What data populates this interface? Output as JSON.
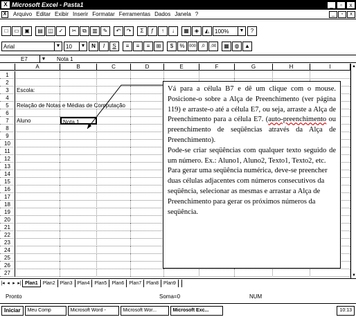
{
  "window": {
    "app_icon": "X",
    "title": "Microsoft Excel - Pasta1",
    "buttons": [
      "_",
      "▫",
      "x"
    ]
  },
  "menubar": {
    "items": [
      "Arquivo",
      "Editar",
      "Exibir",
      "Inserir",
      "Formatar",
      "Ferramentas",
      "Dados",
      "Janela",
      "?"
    ],
    "doc_buttons": [
      "_",
      "▫",
      "x"
    ]
  },
  "toolbar_standard": {
    "zoom": "100%",
    "icons": [
      "new-icon",
      "open-icon",
      "save-icon",
      "print-icon",
      "preview-icon",
      "spelling-icon",
      "cut-icon",
      "copy-icon",
      "paste-icon",
      "format-painter-icon",
      "undo-icon",
      "redo-icon",
      "autosum-icon",
      "function-icon",
      "sort-asc-icon",
      "sort-desc-icon",
      "chart-wizard-icon",
      "map-icon",
      "drawing-icon",
      "help-icon"
    ]
  },
  "toolbar_format": {
    "font": "Arial",
    "size": "10",
    "bold": "N",
    "italic": "I",
    "underline": "S",
    "currency": "$",
    "percent": "%",
    "thousands": "000",
    "dec_inc": ",0",
    "dec_dec": ",00"
  },
  "formula_bar": {
    "name_box": "E7",
    "content": "Nota 1"
  },
  "columns": [
    "A",
    "B",
    "C",
    "D",
    "E",
    "F",
    "G",
    "H",
    "I"
  ],
  "rows": [
    {
      "n": "1",
      "a": "",
      "b": ""
    },
    {
      "n": "2",
      "a": "",
      "b": ""
    },
    {
      "n": "3",
      "a": "Escola:",
      "b": ""
    },
    {
      "n": "4",
      "a": "",
      "b": ""
    },
    {
      "n": "5",
      "a": "Relação de Notas e Médias de Computação",
      "b": ""
    },
    {
      "n": "6",
      "a": "",
      "b": ""
    },
    {
      "n": "7",
      "a": "Aluno",
      "b": "Nota 1"
    },
    {
      "n": "8",
      "a": "",
      "b": ""
    },
    {
      "n": "9",
      "a": "",
      "b": ""
    },
    {
      "n": "10",
      "a": "",
      "b": ""
    },
    {
      "n": "11",
      "a": "",
      "b": ""
    },
    {
      "n": "12",
      "a": "",
      "b": ""
    },
    {
      "n": "13",
      "a": "",
      "b": ""
    },
    {
      "n": "14",
      "a": "",
      "b": ""
    },
    {
      "n": "15",
      "a": "",
      "b": ""
    },
    {
      "n": "16",
      "a": "",
      "b": ""
    },
    {
      "n": "17",
      "a": "",
      "b": ""
    },
    {
      "n": "18",
      "a": "",
      "b": ""
    },
    {
      "n": "19",
      "a": "",
      "b": ""
    },
    {
      "n": "20",
      "a": "",
      "b": ""
    },
    {
      "n": "21",
      "a": "",
      "b": ""
    },
    {
      "n": "22",
      "a": "",
      "b": ""
    },
    {
      "n": "23",
      "a": "",
      "b": ""
    },
    {
      "n": "24",
      "a": "",
      "b": ""
    },
    {
      "n": "25",
      "a": "",
      "b": ""
    },
    {
      "n": "26",
      "a": "",
      "b": ""
    },
    {
      "n": "27",
      "a": "",
      "b": ""
    }
  ],
  "sheet_tabs": [
    "Plan1",
    "Plan2",
    "Plan3",
    "Plan4",
    "Plan5",
    "Plan6",
    "Plan7",
    "Plan8",
    "Plan9"
  ],
  "status": {
    "text": "Pronto",
    "sum": "Soma=0",
    "num": "NUM"
  },
  "taskbar": {
    "start": "Iniciar",
    "tasks": [
      "Meu Comp",
      "Microsoft Word -",
      "Microsoft Wor...",
      "Microsoft Exc..."
    ],
    "clock": "10:13"
  },
  "callout": {
    "p1_a": "Vá para a célula B7 e dê um clique com o mouse. Posicione-o sobre a Alça de Preenchimento (ver página 119) e arraste-o até a célula E7, ou seja, arraste a Alça de Preenchimento para a célula E7. (",
    "p1_red": "auto-preenchimento",
    "p1_b": " ou preenchimento de seqüências através da Alça de Preenchimento).",
    "p2": "Pode-se criar seqüências com qualquer texto seguido de um número. Ex.: Aluno1, Aluno2, Texto1, Texto2, etc.",
    "p3": "Para gerar uma seqüência numérica, deve-se preencher duas células adjacentes com números consecutivos da seqüência, selecionar as mesmas e arrastar a Alça de Preenchimento para gerar os próximos números da seqüência."
  }
}
